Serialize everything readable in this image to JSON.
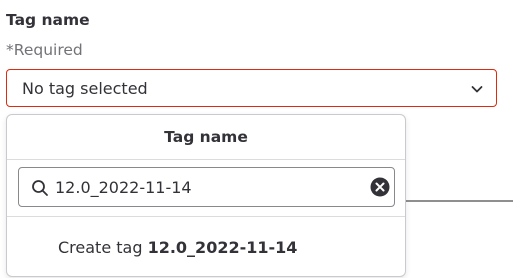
{
  "field": {
    "label": "Tag name",
    "required_text": "*Required"
  },
  "select": {
    "value": "No tag selected",
    "icon": "chevron-down-icon"
  },
  "dropdown": {
    "header": "Tag name",
    "search": {
      "value": "12.0_2022-11-14",
      "icon": "search-icon",
      "clear_icon": "clear-icon"
    },
    "create": {
      "prefix": "Create tag ",
      "tag_name": "12.0_2022-11-14"
    }
  },
  "colors": {
    "error_border": "#dd2b0e",
    "text": "#333238",
    "muted_text": "#737278"
  }
}
